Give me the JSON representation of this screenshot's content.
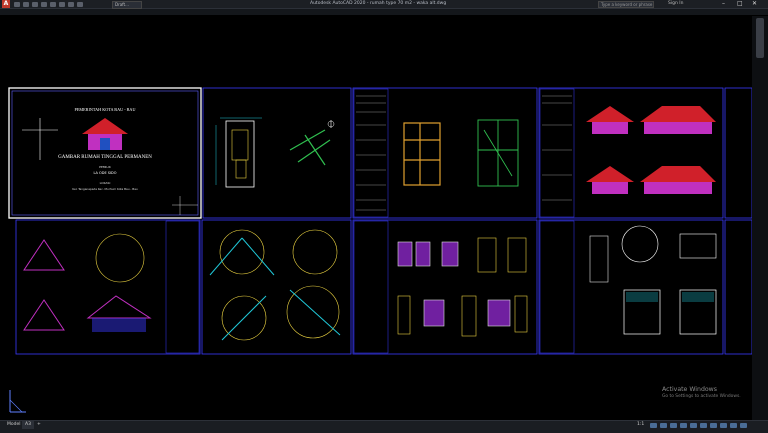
{
  "window": {
    "app_logo": "A",
    "title": "Autodesk AutoCAD 2020 - rumah type 70 m2 - waka alt.dwg",
    "workspace": "Draft...",
    "search_placeholder": "Type a keyword or phrase",
    "sign_in": "Sign In",
    "minimize": "–",
    "maximize": "□",
    "close": "✕"
  },
  "document_tab": {
    "label": "rumah type 70 m2 - waka alt"
  },
  "cover_sheet": {
    "header": "PEMERINTAH KOTA BAU - BAU",
    "title": "GAMBAR RUMAH TINGGAL PERMANEN",
    "owner_label": "PEMILIK",
    "owner_name": "LA ODE SIDO",
    "location_label": "LOKASI",
    "location": "Kel. Tanganapada Kec. Murhum Kota Bau - Bau"
  },
  "statusbar": {
    "model_tab": "Model",
    "layout_tab": "A3",
    "add_tab": "+",
    "scale": "1:1"
  },
  "watermark": {
    "line1": "Activate Windows",
    "line2": "Go to Settings to activate Windows."
  },
  "colors": {
    "sheet_border": "#3a3aff",
    "roof_red": "#d0202a",
    "wall_magenta": "#c030c0",
    "cyan": "#20c8d8",
    "yellow": "#e8d040",
    "green": "#30c050"
  }
}
